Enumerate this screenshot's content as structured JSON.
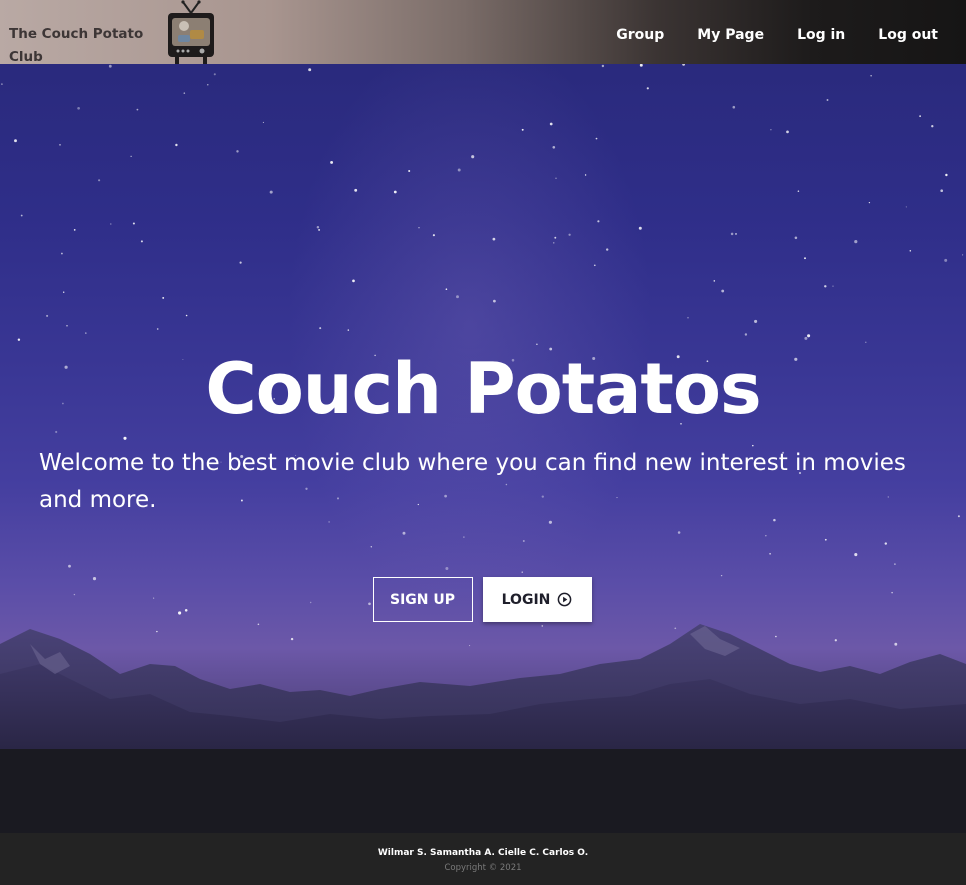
{
  "navbar": {
    "brand": "The Couch Potato Club",
    "logo_icon": "tv-icon",
    "links": [
      "Group",
      "My Page",
      "Log in",
      "Log out"
    ]
  },
  "hero": {
    "title": "Couch Potatos",
    "subtitle": "Welcome to the best movie club where you can find new interest in movies and more.",
    "signup_label": "SIGN UP",
    "login_label": "LOGIN",
    "login_icon": "play-circle-icon"
  },
  "footer": {
    "authors": "Wilmar S. Samantha A. Cielle C. Carlos O.",
    "copyright": "Copyright © 2021"
  },
  "colors": {
    "navbar_start": "#b9a9a4",
    "navbar_end": "#161515",
    "sky": "#3a3795",
    "footer_bg": "#232323",
    "text_light": "#ffffff"
  }
}
